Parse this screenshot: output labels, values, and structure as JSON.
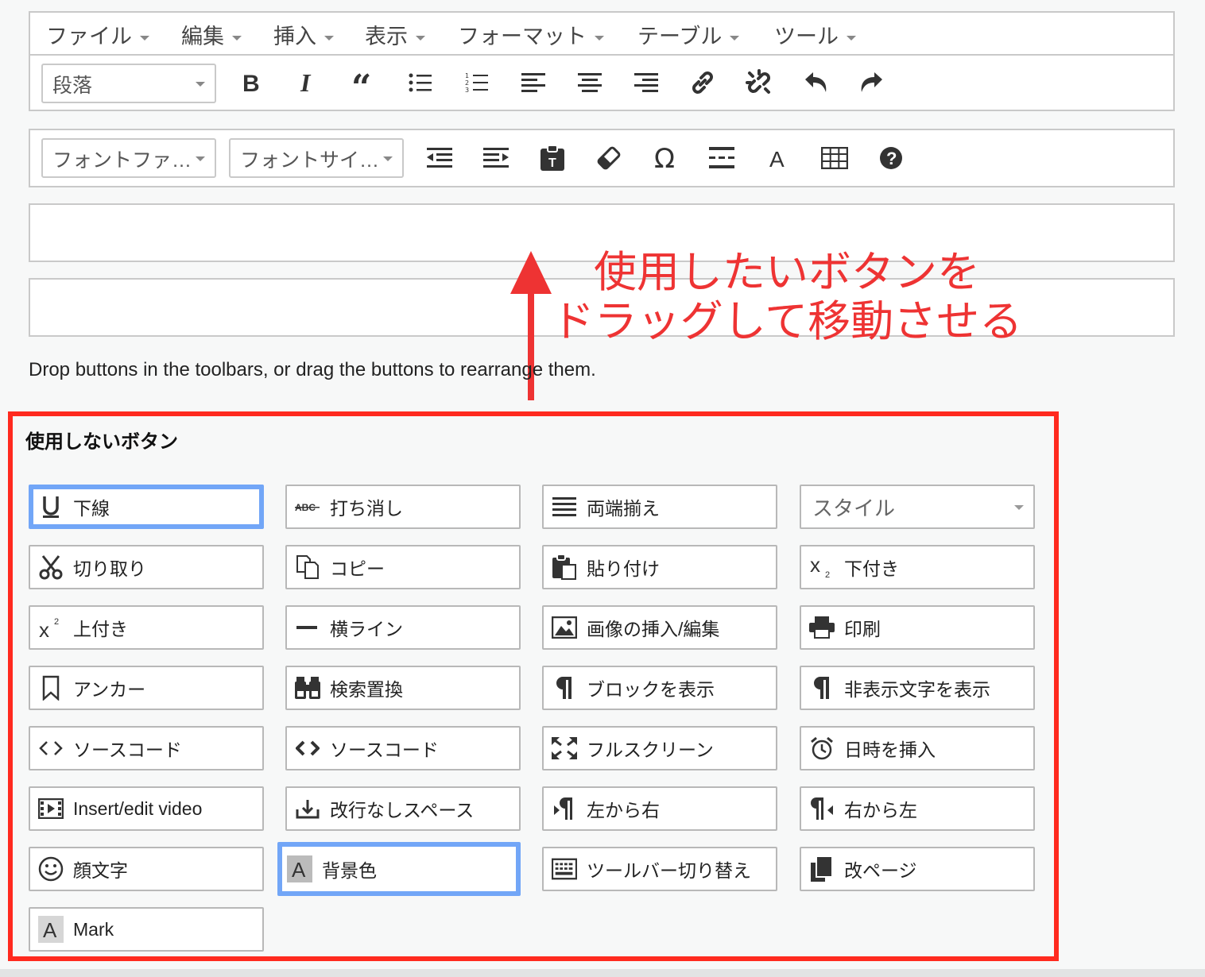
{
  "menubar": {
    "items": [
      "ファイル",
      "編集",
      "挿入",
      "表示",
      "フォーマット",
      "テーブル",
      "ツール"
    ]
  },
  "toolbar1": {
    "format_select": "段落",
    "buttons": [
      "bold-icon",
      "italic-icon",
      "blockquote-icon",
      "bullet-list-icon",
      "numbered-list-icon",
      "align-left-icon",
      "align-center-icon",
      "align-right-icon",
      "link-icon",
      "unlink-icon",
      "undo-icon",
      "redo-icon"
    ]
  },
  "toolbar2": {
    "font_family_select": "フォントファ…",
    "font_size_select": "フォントサイ…",
    "buttons": [
      "outdent-icon",
      "indent-icon",
      "paste-text-icon",
      "eraser-icon",
      "omega-icon",
      "page-break-icon",
      "text-color-icon",
      "table-icon",
      "help-icon"
    ]
  },
  "instruction": "Drop buttons in the toolbars, or drag the buttons to rearrange them.",
  "annotation": {
    "line1": "使用したいボタンを",
    "line2": "ドラッグして移動させる",
    "color": "#ee3333"
  },
  "unused": {
    "title": "使用しないボタン",
    "border_color": "#ff2a1f",
    "highlight_color": "#72a6f7",
    "buttons": [
      {
        "label": "下線",
        "icon": "underline-icon",
        "selected": true
      },
      {
        "label": "打ち消し",
        "icon": "strikethrough-icon"
      },
      {
        "label": "両端揃え",
        "icon": "justify-icon"
      },
      {
        "label": "スタイル",
        "icon": "",
        "select": true
      },
      {
        "label": "切り取り",
        "icon": "scissors-icon"
      },
      {
        "label": "コピー",
        "icon": "copy-icon"
      },
      {
        "label": "貼り付け",
        "icon": "paste-icon"
      },
      {
        "label": "下付き",
        "icon": "subscript-icon"
      },
      {
        "label": "上付き",
        "icon": "superscript-icon"
      },
      {
        "label": "横ライン",
        "icon": "horizontal-line-icon"
      },
      {
        "label": "画像の挿入/編集",
        "icon": "image-icon"
      },
      {
        "label": "印刷",
        "icon": "print-icon"
      },
      {
        "label": "アンカー",
        "icon": "bookmark-icon"
      },
      {
        "label": "検索置換",
        "icon": "binoculars-icon"
      },
      {
        "label": "ブロックを表示",
        "icon": "pilcrow-icon"
      },
      {
        "label": "非表示文字を表示",
        "icon": "pilcrow-icon"
      },
      {
        "label": "ソースコード",
        "icon": "code-icon"
      },
      {
        "label": "ソースコード",
        "icon": "code-bold-icon"
      },
      {
        "label": "フルスクリーン",
        "icon": "fullscreen-icon"
      },
      {
        "label": "日時を挿入",
        "icon": "alarm-clock-icon"
      },
      {
        "label": "Insert/edit video",
        "icon": "video-icon"
      },
      {
        "label": "改行なしスペース",
        "icon": "nbsp-icon"
      },
      {
        "label": "左から右",
        "icon": "ltr-icon"
      },
      {
        "label": "右から左",
        "icon": "rtl-icon"
      },
      {
        "label": "顔文字",
        "icon": "emoticon-icon"
      },
      {
        "label": "背景色",
        "icon": "background-color-icon",
        "selected": true
      },
      {
        "label": "ツールバー切り替え",
        "icon": "keyboard-icon"
      },
      {
        "label": "改ページ",
        "icon": "page-break-pages-icon"
      },
      {
        "label": "Mark",
        "icon": "mark-icon"
      }
    ]
  }
}
